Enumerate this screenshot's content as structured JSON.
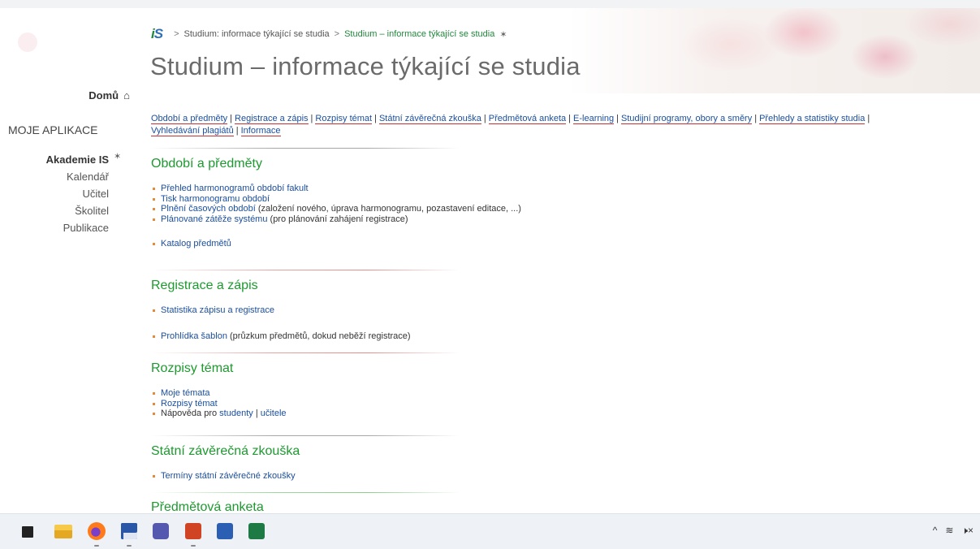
{
  "breadcrumb": {
    "logo_i": "i",
    "logo_s": "S",
    "separator": ">",
    "parent": "Studium: informace týkající se studia",
    "current": "Studium – informace týkající se studia",
    "pin_icon": "pin-icon"
  },
  "page_title": "Studium – informace týkající se studia",
  "sidebar": {
    "home_label": "Domů",
    "home_icon": "home-icon",
    "apps_title": "MOJE APLIKACE",
    "items": [
      {
        "label": "Akademie IS",
        "active": true
      },
      {
        "label": "Kalendář"
      },
      {
        "label": "Učitel"
      },
      {
        "label": "Školitel"
      },
      {
        "label": "Publikace"
      }
    ]
  },
  "tabs": [
    "Období a předměty",
    "Registrace a zápis",
    "Rozpisy témat",
    "Státní závěrečná zkouška",
    "Předmětová anketa",
    "E-learning",
    "Studijní programy, obory a směry",
    "Přehledy a statistiky studia",
    "Vyhledávání plagiátů",
    "Informace"
  ],
  "tab_separator": "|",
  "sections": {
    "obdobi": {
      "title": "Období a předměty",
      "i1": "Přehled harmonogramů období fakult",
      "i2": "Tisk harmonogramu období",
      "i3_link": "Plnění časových období",
      "i3_rest": " (založení nového, úprava harmonogramu, pozastavení editace, ...)",
      "i4_link": "Plánované zátěže systému",
      "i4_rest": " (pro plánování zahájení registrace)",
      "i5": "Katalog předmětů"
    },
    "registrace": {
      "title": "Registrace a zápis",
      "i1": "Statistika zápisu a registrace",
      "i2_link": "Prohlídka šablon",
      "i2_rest": " (průzkum předmětů, dokud neběží registrace)"
    },
    "rozpisy": {
      "title": "Rozpisy témat",
      "i1": "Moje témata",
      "i2": "Rozpisy témat",
      "i3_text": "Nápověda pro ",
      "i3_link1": "studenty",
      "i3_sep": " | ",
      "i3_link2": "učitele"
    },
    "szz": {
      "title": "Státní závěrečná zkouška",
      "i1": "Termíny státní závěrečné zkoušky"
    },
    "anketa": {
      "title": "Předmětová anketa"
    }
  },
  "taskbar": {
    "icons": [
      "task-view-icon",
      "file-explorer-icon",
      "firefox-icon",
      "save-icon",
      "teams-icon",
      "powerpoint-icon",
      "word-icon",
      "excel-icon"
    ],
    "tray": {
      "chevron": "^",
      "wifi": "≋",
      "volume": "🕨×"
    }
  },
  "colors": {
    "link": "#1a4fa0",
    "section_title": "#1d9a2f",
    "bullet": "#e58a3a"
  }
}
